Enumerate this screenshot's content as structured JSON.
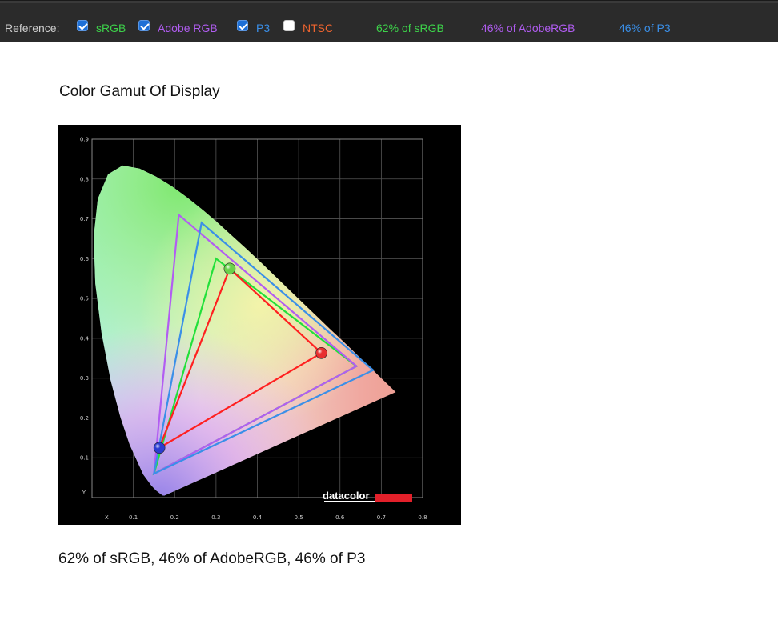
{
  "toolbar": {
    "reference_label": "Reference:",
    "options": [
      {
        "id": "srgb",
        "label": "sRGB",
        "checked": true,
        "color": "#3dd14a"
      },
      {
        "id": "adobe",
        "label": "Adobe RGB",
        "checked": true,
        "color": "#b05cf0"
      },
      {
        "id": "p3",
        "label": "P3",
        "checked": true,
        "color": "#3a8fe8"
      },
      {
        "id": "ntsc",
        "label": "NTSC",
        "checked": false,
        "color": "#f0642e"
      }
    ],
    "coverage": [
      {
        "text": "62% of sRGB",
        "color": "#3dd14a"
      },
      {
        "text": "46% of AdobeRGB",
        "color": "#b05cf0"
      },
      {
        "text": "46% of P3",
        "color": "#3a8fe8"
      }
    ]
  },
  "page": {
    "title": "Color Gamut Of Display",
    "caption": "62% of sRGB, 46% of AdobeRGB, 46% of P3"
  },
  "chart_data": {
    "type": "scatter",
    "title": "",
    "xlabel": "X",
    "ylabel": "Y",
    "xlim": [
      0,
      0.8
    ],
    "ylim": [
      0,
      0.9
    ],
    "x_ticks": [
      "0.1",
      "0.2",
      "0.3",
      "0.4",
      "0.5",
      "0.6",
      "0.7",
      "0.8"
    ],
    "y_ticks": [
      "0.1",
      "0.2",
      "0.3",
      "0.4",
      "0.5",
      "0.6",
      "0.7",
      "0.8",
      "0.9"
    ],
    "grid": true,
    "watermark": "datacolor",
    "spectral_locus": [
      [
        0.175,
        0.005
      ],
      [
        0.172,
        0.005
      ],
      [
        0.166,
        0.009
      ],
      [
        0.155,
        0.018
      ],
      [
        0.144,
        0.03
      ],
      [
        0.124,
        0.058
      ],
      [
        0.091,
        0.133
      ],
      [
        0.069,
        0.201
      ],
      [
        0.045,
        0.295
      ],
      [
        0.023,
        0.413
      ],
      [
        0.008,
        0.538
      ],
      [
        0.004,
        0.655
      ],
      [
        0.014,
        0.75
      ],
      [
        0.039,
        0.812
      ],
      [
        0.074,
        0.834
      ],
      [
        0.115,
        0.826
      ],
      [
        0.155,
        0.806
      ],
      [
        0.193,
        0.782
      ],
      [
        0.23,
        0.754
      ],
      [
        0.266,
        0.724
      ],
      [
        0.302,
        0.692
      ],
      [
        0.337,
        0.659
      ],
      [
        0.373,
        0.625
      ],
      [
        0.408,
        0.591
      ],
      [
        0.444,
        0.555
      ],
      [
        0.479,
        0.52
      ],
      [
        0.512,
        0.487
      ],
      [
        0.545,
        0.454
      ],
      [
        0.575,
        0.424
      ],
      [
        0.603,
        0.397
      ],
      [
        0.627,
        0.373
      ],
      [
        0.648,
        0.352
      ],
      [
        0.666,
        0.334
      ],
      [
        0.68,
        0.32
      ],
      [
        0.691,
        0.309
      ],
      [
        0.735,
        0.265
      ]
    ],
    "series": [
      {
        "name": "sRGB",
        "color": "#22e03a",
        "points": [
          [
            0.64,
            0.33
          ],
          [
            0.3,
            0.6
          ],
          [
            0.15,
            0.06
          ]
        ]
      },
      {
        "name": "Adobe RGB",
        "color": "#b25df2",
        "points": [
          [
            0.64,
            0.33
          ],
          [
            0.21,
            0.71
          ],
          [
            0.15,
            0.06
          ]
        ]
      },
      {
        "name": "P3",
        "color": "#3a8fe8",
        "points": [
          [
            0.68,
            0.32
          ],
          [
            0.265,
            0.69
          ],
          [
            0.15,
            0.06
          ]
        ]
      },
      {
        "name": "",
        "color": "#ff2020",
        "points": [
          [
            0.555,
            0.363
          ],
          [
            0.333,
            0.575
          ],
          [
            0.163,
            0.125
          ]
        ]
      }
    ],
    "primaries": [
      {
        "x": 0.555,
        "y": 0.363,
        "color": "#e83030"
      },
      {
        "x": 0.333,
        "y": 0.575,
        "color": "#6ad24a"
      },
      {
        "x": 0.163,
        "y": 0.125,
        "color": "#2a3cd0"
      }
    ]
  }
}
